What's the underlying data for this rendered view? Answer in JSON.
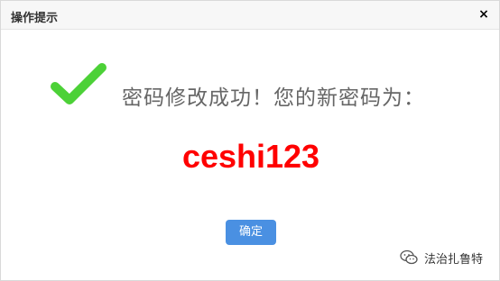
{
  "dialog": {
    "title": "操作提示",
    "close_symbol": "×"
  },
  "content": {
    "icon": "success-check-icon",
    "message": "密码修改成功！您的新密码为：",
    "new_password": "ceshi123",
    "confirm_label": "确定"
  },
  "watermark": {
    "icon": "wechat-icon",
    "text": "法治扎鲁特"
  },
  "colors": {
    "check": "#4cd137",
    "password": "#ff0000",
    "button": "#4a90e2",
    "titlebar": "#f7f7f7"
  }
}
